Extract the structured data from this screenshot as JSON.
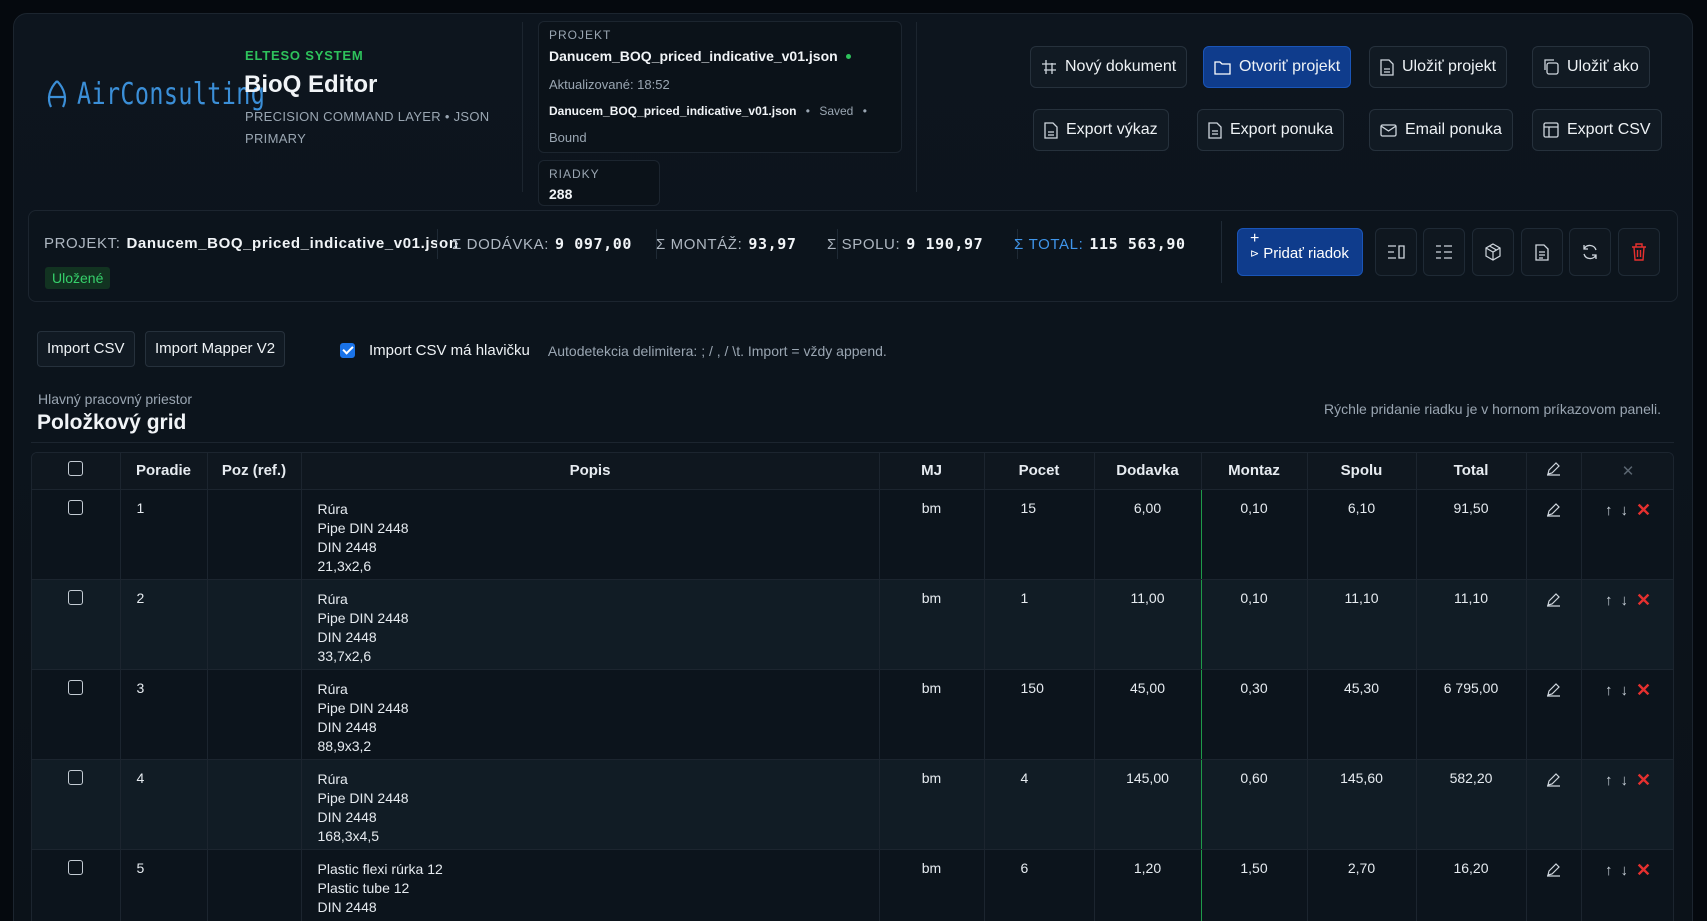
{
  "brand": {
    "logo": "AirConsulting",
    "system": "ELTESO SYSTEM",
    "title": "BioQ Editor",
    "subtitle": "PRECISION COMMAND LAYER • JSON PRIMARY"
  },
  "project": {
    "label": "PROJEKT",
    "name": "Danucem_BOQ_priced_indicative_v01.json",
    "updated": "Aktualizované: 18:52",
    "file": "Danucem_BOQ_priced_indicative_v01.json",
    "saved": "Saved",
    "bound": "Bound",
    "rows_label": "RIADKY",
    "rows_value": "288"
  },
  "toolbar": {
    "new_doc": "Nový dokument",
    "open_project": "Otvoriť projekt",
    "save_project": "Uložiť projekt",
    "save_as": "Uložiť ako",
    "export_report": "Export výkaz",
    "export_offer": "Export ponuka",
    "email_offer": "Email ponuka",
    "export_csv": "Export CSV"
  },
  "summary": {
    "project_label": "PROJEKT:",
    "project_value": "Danucem_BOQ_priced_indicative_v01.json",
    "dodavka_label": "Σ DODÁVKA:",
    "dodavka_value": "9 097,00",
    "montaz_label": "Σ MONTÁŽ:",
    "montaz_value": "93,97",
    "spolu_label": "Σ SPOLU:",
    "spolu_value": "9 190,97",
    "total_label": "Σ TOTAL:",
    "total_value": "115 563,90",
    "status": "Uložené",
    "add_row": "Pridať riadok",
    "accent": "#3f95ea"
  },
  "import": {
    "csv": "Import CSV",
    "mapper": "Import Mapper V2",
    "has_header": "Import CSV má hlavičku",
    "has_header_checked": true,
    "hint": "Autodetekcia delimitera: ; / , / \\t. Import = vždy append."
  },
  "workspace": {
    "kicker": "Hlavný pracovný priestor",
    "title": "Položkový grid",
    "hint": "Rýchle pridanie riadku je v hornom príkazovom paneli."
  },
  "grid": {
    "columns": [
      "Poradie",
      "Poz (ref.)",
      "Popis",
      "MJ",
      "Pocet",
      "Dodavka",
      "Montaz",
      "Spolu",
      "Total"
    ],
    "rows": [
      {
        "poradie": "1",
        "poz": "",
        "popis": [
          "Rúra",
          "Pipe DIN 2448",
          "DIN 2448",
          "21,3x2,6"
        ],
        "mj": "bm",
        "pocet": "15",
        "dodavka": "6,00",
        "montaz": "0,10",
        "spolu": "6,10",
        "total": "91,50"
      },
      {
        "poradie": "2",
        "poz": "",
        "popis": [
          "Rúra",
          "Pipe DIN 2448",
          "DIN 2448",
          "33,7x2,6"
        ],
        "mj": "bm",
        "pocet": "1",
        "dodavka": "11,00",
        "montaz": "0,10",
        "spolu": "11,10",
        "total": "11,10"
      },
      {
        "poradie": "3",
        "poz": "",
        "popis": [
          "Rúra",
          "Pipe DIN 2448",
          "DIN 2448",
          "88,9x3,2"
        ],
        "mj": "bm",
        "pocet": "150",
        "dodavka": "45,00",
        "montaz": "0,30",
        "spolu": "45,30",
        "total": "6 795,00"
      },
      {
        "poradie": "4",
        "poz": "",
        "popis": [
          "Rúra",
          "Pipe DIN 2448",
          "DIN 2448",
          "168,3x4,5"
        ],
        "mj": "bm",
        "pocet": "4",
        "dodavka": "145,00",
        "montaz": "0,60",
        "spolu": "145,60",
        "total": "582,20"
      },
      {
        "poradie": "5",
        "poz": "",
        "popis": [
          "Plastic flexi rúrka 12",
          "Plastic tube 12",
          "DIN 2448"
        ],
        "mj": "bm",
        "pocet": "6",
        "dodavka": "1,20",
        "montaz": "1,50",
        "spolu": "2,70",
        "total": "16,20"
      }
    ]
  }
}
